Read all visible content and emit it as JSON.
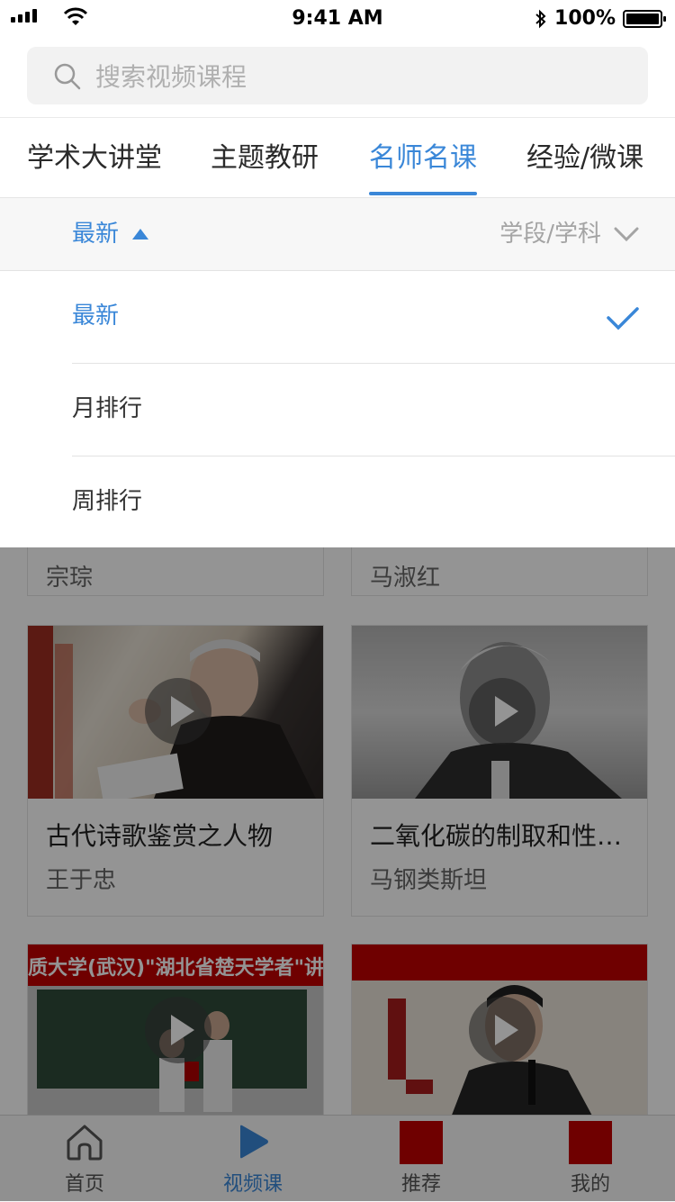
{
  "status_bar": {
    "time": "9:41 AM",
    "battery": "100%"
  },
  "search": {
    "placeholder": "搜索视频课程"
  },
  "tabs": [
    {
      "label": "学术大讲堂"
    },
    {
      "label": "主题教研"
    },
    {
      "label": "名师名课"
    },
    {
      "label": "经验/微课"
    }
  ],
  "active_tab": 2,
  "filter": {
    "sort_label": "最新",
    "subject_label": "学段/学科"
  },
  "sort_options": [
    {
      "label": "最新",
      "selected": true
    },
    {
      "label": "月排行",
      "selected": false
    },
    {
      "label": "周排行",
      "selected": false
    }
  ],
  "courses": [
    {
      "title": "",
      "author": "宗琮"
    },
    {
      "title": "",
      "author": "马淑红"
    },
    {
      "title": "古代诗歌鉴赏之人物",
      "author": "王于忠"
    },
    {
      "title": "二氧化碳的制取和性…",
      "author": "马钢类斯坦"
    },
    {
      "title": "",
      "author": ""
    },
    {
      "title": "",
      "author": ""
    }
  ],
  "thumb_texts": {
    "banner": "质大学(武汉)\"湖北省楚天学者\"讲座教授"
  },
  "tab_bar": [
    {
      "label": "首页",
      "icon": "home-icon"
    },
    {
      "label": "视频课",
      "icon": "play-icon"
    },
    {
      "label": "推荐",
      "icon": "recommend-icon"
    },
    {
      "label": "我的",
      "icon": "profile-icon"
    }
  ],
  "colors": {
    "accent": "#3a87d8",
    "placeholder_red": "#c00000"
  }
}
